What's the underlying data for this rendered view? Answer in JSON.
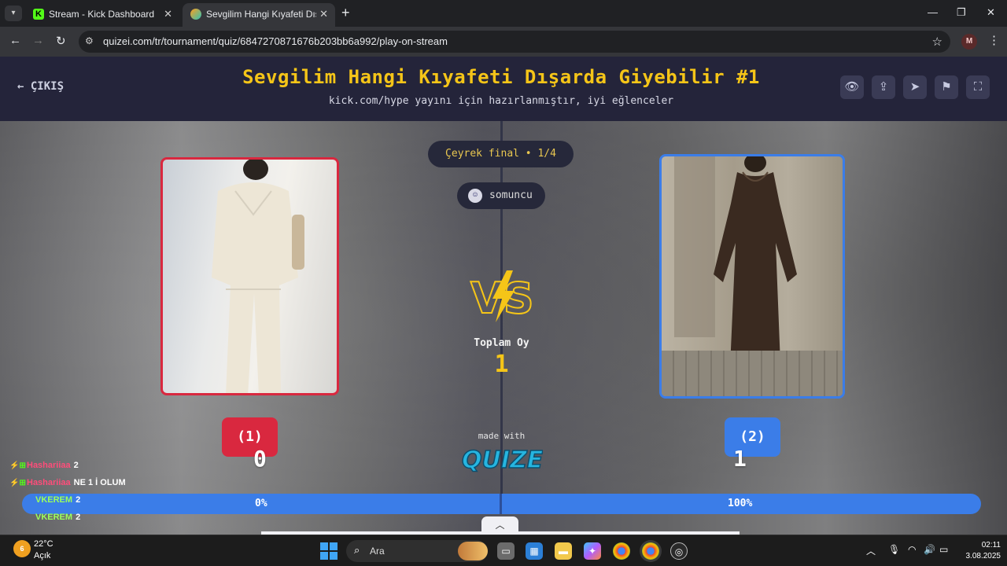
{
  "browser": {
    "tabs": [
      {
        "title": "Stream - Kick Dashboard",
        "favicon": "kick-logo"
      },
      {
        "title": "Sevgilim Hangi Kıyafeti Dışarda",
        "favicon": "quizei-logo"
      }
    ],
    "url": "quizei.com/tr/tournament/quiz/6847270871676b203bb6a992/play-on-stream",
    "profile_initial": "M"
  },
  "header": {
    "back_label": "ÇIKIŞ",
    "title": "Sevgilim Hangi Kıyafeti Dışarda Giyebilir #1",
    "subtitle": "kick.com/hype yayını için hazırlanmıştır, iyi eğlenceler",
    "actions": [
      "eye-icon",
      "share-icon",
      "send-icon",
      "flag-icon",
      "fullscreen-icon"
    ]
  },
  "match": {
    "round": "Çeyrek final • 1/4",
    "creator": "somuncu",
    "total_label": "Toplam Oy",
    "total_value": "1",
    "left": {
      "label": "(1)",
      "score": "0",
      "percent": "0%",
      "share": 0,
      "color": "#d9283f"
    },
    "right": {
      "label": "(2)",
      "score": "1",
      "percent": "100%",
      "share": 1,
      "color": "#3b7de8"
    }
  },
  "branding": {
    "made_with": "made with",
    "logo_text": "QUIZEI"
  },
  "chat": [
    {
      "user": "Hashariiaa",
      "message": "2",
      "badge": true
    },
    {
      "user": "Hashariiaa",
      "message": "NE 1 İ OLUM",
      "badge": true
    },
    {
      "user": "VKEREM",
      "message": "2",
      "badge": false
    },
    {
      "user": "VKEREM",
      "message": "2",
      "badge": false
    }
  ],
  "taskbar": {
    "weather_temp": "22°C",
    "weather_condition": "Açık",
    "weather_badge": "6",
    "search_placeholder": "Ara",
    "time": "02:11",
    "date": "3.08.2025"
  }
}
